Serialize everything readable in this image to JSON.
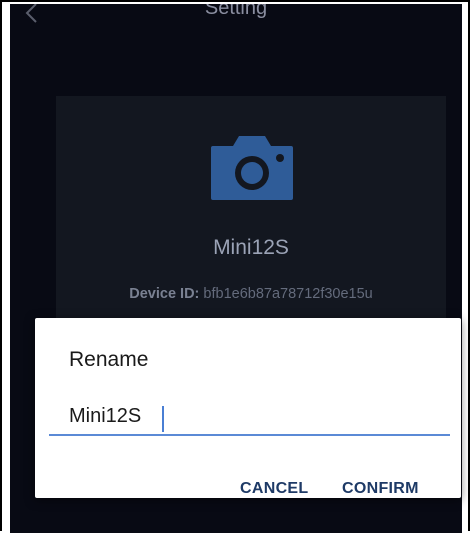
{
  "header": {
    "title": "Setting"
  },
  "device": {
    "name": "Mini12S",
    "id_label": "Device ID:",
    "id_value": "bfb1e6b87a78712f30e15u"
  },
  "dialog": {
    "title": "Rename",
    "input_value": "Mini12S",
    "cancel_label": "CANCEL",
    "confirm_label": "CONFIRM"
  },
  "colors": {
    "background": "#080a14",
    "card": "#131720",
    "camera_icon": "#2f5c98",
    "input_underline": "#5b8ad6",
    "button_text": "#1e3a66"
  },
  "icons": {
    "back": "chevron-left-icon",
    "device": "camera-icon"
  }
}
